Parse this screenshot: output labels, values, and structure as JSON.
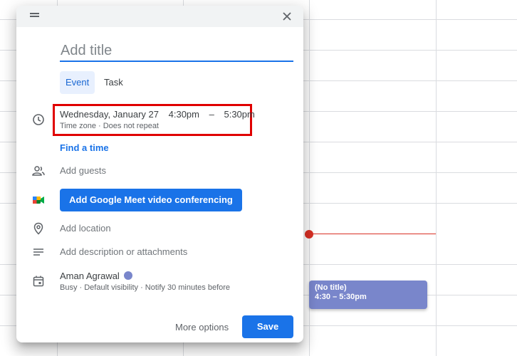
{
  "dialog": {
    "title_placeholder": "Add title",
    "tabs": [
      {
        "label": "Event",
        "active": true
      },
      {
        "label": "Task",
        "active": false
      }
    ],
    "time": {
      "date": "Wednesday, January 27",
      "start": "4:30pm",
      "separator": "–",
      "end": "5:30pm",
      "sub": "Time zone · Does not repeat"
    },
    "find_time": "Find a time",
    "add_guests": "Add guests",
    "meet_button": "Add Google Meet video conferencing",
    "add_location": "Add location",
    "add_description": "Add description or attachments",
    "owner": {
      "name": "Aman Agrawal",
      "color": "#7986cb",
      "sub": "Busy · Default visibility · Notify 30 minutes before"
    },
    "more_options": "More options",
    "save": "Save"
  },
  "calendar": {
    "event_chip": {
      "title": "(No title)",
      "time": "4:30 – 5:30pm",
      "color": "#7986cb"
    },
    "now_indicator_color": "#d93025"
  },
  "icons": [
    "drag-handle-icon",
    "close-icon",
    "clock-icon",
    "people-icon",
    "google-meet-icon",
    "location-pin-icon",
    "notes-icon",
    "calendar-icon"
  ],
  "colors": {
    "accent": "#1a73e8",
    "highlight_box": "#e00000"
  }
}
